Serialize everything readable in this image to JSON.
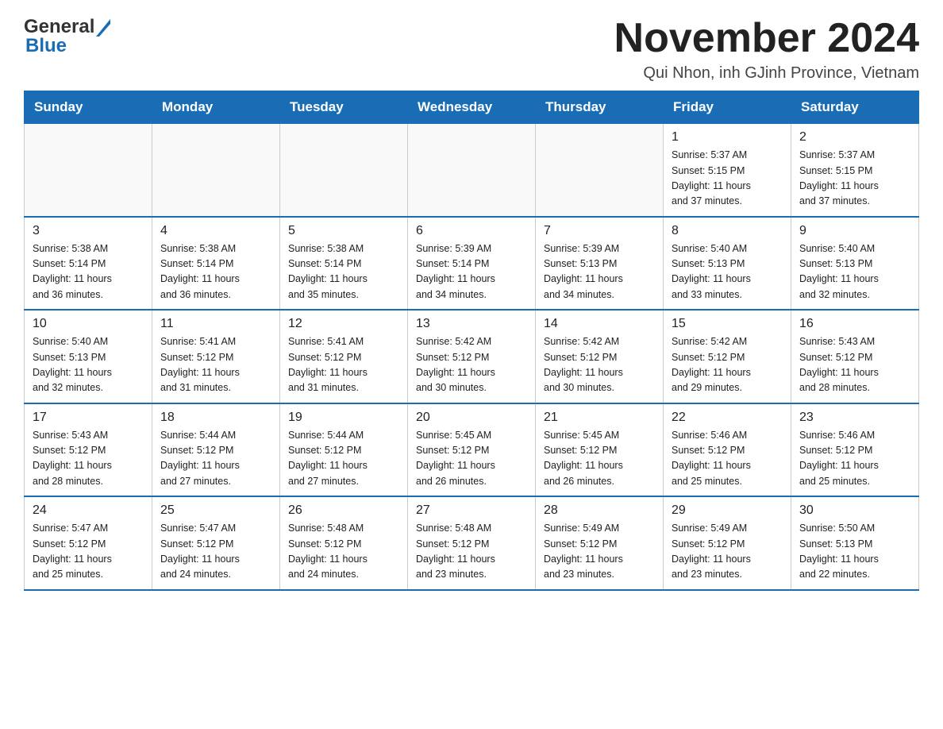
{
  "header": {
    "logo_general": "General",
    "logo_blue": "Blue",
    "title": "November 2024",
    "subtitle": "Qui Nhon, inh GJinh Province, Vietnam"
  },
  "calendar": {
    "days_of_week": [
      "Sunday",
      "Monday",
      "Tuesday",
      "Wednesday",
      "Thursday",
      "Friday",
      "Saturday"
    ],
    "weeks": [
      [
        {
          "day": "",
          "info": ""
        },
        {
          "day": "",
          "info": ""
        },
        {
          "day": "",
          "info": ""
        },
        {
          "day": "",
          "info": ""
        },
        {
          "day": "",
          "info": ""
        },
        {
          "day": "1",
          "info": "Sunrise: 5:37 AM\nSunset: 5:15 PM\nDaylight: 11 hours\nand 37 minutes."
        },
        {
          "day": "2",
          "info": "Sunrise: 5:37 AM\nSunset: 5:15 PM\nDaylight: 11 hours\nand 37 minutes."
        }
      ],
      [
        {
          "day": "3",
          "info": "Sunrise: 5:38 AM\nSunset: 5:14 PM\nDaylight: 11 hours\nand 36 minutes."
        },
        {
          "day": "4",
          "info": "Sunrise: 5:38 AM\nSunset: 5:14 PM\nDaylight: 11 hours\nand 36 minutes."
        },
        {
          "day": "5",
          "info": "Sunrise: 5:38 AM\nSunset: 5:14 PM\nDaylight: 11 hours\nand 35 minutes."
        },
        {
          "day": "6",
          "info": "Sunrise: 5:39 AM\nSunset: 5:14 PM\nDaylight: 11 hours\nand 34 minutes."
        },
        {
          "day": "7",
          "info": "Sunrise: 5:39 AM\nSunset: 5:13 PM\nDaylight: 11 hours\nand 34 minutes."
        },
        {
          "day": "8",
          "info": "Sunrise: 5:40 AM\nSunset: 5:13 PM\nDaylight: 11 hours\nand 33 minutes."
        },
        {
          "day": "9",
          "info": "Sunrise: 5:40 AM\nSunset: 5:13 PM\nDaylight: 11 hours\nand 32 minutes."
        }
      ],
      [
        {
          "day": "10",
          "info": "Sunrise: 5:40 AM\nSunset: 5:13 PM\nDaylight: 11 hours\nand 32 minutes."
        },
        {
          "day": "11",
          "info": "Sunrise: 5:41 AM\nSunset: 5:12 PM\nDaylight: 11 hours\nand 31 minutes."
        },
        {
          "day": "12",
          "info": "Sunrise: 5:41 AM\nSunset: 5:12 PM\nDaylight: 11 hours\nand 31 minutes."
        },
        {
          "day": "13",
          "info": "Sunrise: 5:42 AM\nSunset: 5:12 PM\nDaylight: 11 hours\nand 30 minutes."
        },
        {
          "day": "14",
          "info": "Sunrise: 5:42 AM\nSunset: 5:12 PM\nDaylight: 11 hours\nand 30 minutes."
        },
        {
          "day": "15",
          "info": "Sunrise: 5:42 AM\nSunset: 5:12 PM\nDaylight: 11 hours\nand 29 minutes."
        },
        {
          "day": "16",
          "info": "Sunrise: 5:43 AM\nSunset: 5:12 PM\nDaylight: 11 hours\nand 28 minutes."
        }
      ],
      [
        {
          "day": "17",
          "info": "Sunrise: 5:43 AM\nSunset: 5:12 PM\nDaylight: 11 hours\nand 28 minutes."
        },
        {
          "day": "18",
          "info": "Sunrise: 5:44 AM\nSunset: 5:12 PM\nDaylight: 11 hours\nand 27 minutes."
        },
        {
          "day": "19",
          "info": "Sunrise: 5:44 AM\nSunset: 5:12 PM\nDaylight: 11 hours\nand 27 minutes."
        },
        {
          "day": "20",
          "info": "Sunrise: 5:45 AM\nSunset: 5:12 PM\nDaylight: 11 hours\nand 26 minutes."
        },
        {
          "day": "21",
          "info": "Sunrise: 5:45 AM\nSunset: 5:12 PM\nDaylight: 11 hours\nand 26 minutes."
        },
        {
          "day": "22",
          "info": "Sunrise: 5:46 AM\nSunset: 5:12 PM\nDaylight: 11 hours\nand 25 minutes."
        },
        {
          "day": "23",
          "info": "Sunrise: 5:46 AM\nSunset: 5:12 PM\nDaylight: 11 hours\nand 25 minutes."
        }
      ],
      [
        {
          "day": "24",
          "info": "Sunrise: 5:47 AM\nSunset: 5:12 PM\nDaylight: 11 hours\nand 25 minutes."
        },
        {
          "day": "25",
          "info": "Sunrise: 5:47 AM\nSunset: 5:12 PM\nDaylight: 11 hours\nand 24 minutes."
        },
        {
          "day": "26",
          "info": "Sunrise: 5:48 AM\nSunset: 5:12 PM\nDaylight: 11 hours\nand 24 minutes."
        },
        {
          "day": "27",
          "info": "Sunrise: 5:48 AM\nSunset: 5:12 PM\nDaylight: 11 hours\nand 23 minutes."
        },
        {
          "day": "28",
          "info": "Sunrise: 5:49 AM\nSunset: 5:12 PM\nDaylight: 11 hours\nand 23 minutes."
        },
        {
          "day": "29",
          "info": "Sunrise: 5:49 AM\nSunset: 5:12 PM\nDaylight: 11 hours\nand 23 minutes."
        },
        {
          "day": "30",
          "info": "Sunrise: 5:50 AM\nSunset: 5:13 PM\nDaylight: 11 hours\nand 22 minutes."
        }
      ]
    ]
  }
}
